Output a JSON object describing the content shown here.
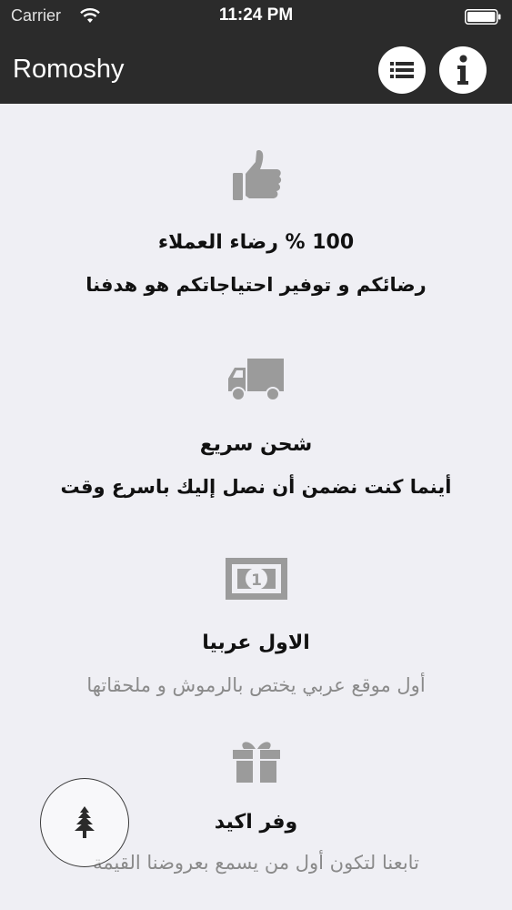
{
  "status_bar": {
    "carrier": "Carrier",
    "time": "11:24 PM"
  },
  "nav": {
    "title": "Romoshy",
    "list_icon": "list-icon",
    "info_icon": "info-icon"
  },
  "features": [
    {
      "icon": "thumbs-up-icon",
      "title": "100 % رضاء العملاء",
      "description": "رضائكم و توفير احتياجاتكم هو هدفنا"
    },
    {
      "icon": "truck-icon",
      "title": "شحن سريع",
      "description": "أينما كنت نضمن أن نصل إليك باسرع وقت"
    },
    {
      "icon": "banknote-icon",
      "title": "الاول عربيا",
      "description": "أول موقع عربي يختص بالرموش و ملحقاتها"
    },
    {
      "icon": "gift-icon",
      "title": "وفر اكيد",
      "description": "تابعنا لتكون أول من يسمع بعروضنا القيمة"
    }
  ],
  "fab": {
    "icon": "tree-icon"
  },
  "colors": {
    "bar_background": "#2b2b2b",
    "page_background": "#efeff4",
    "icon_gray": "#9b9b9b"
  }
}
